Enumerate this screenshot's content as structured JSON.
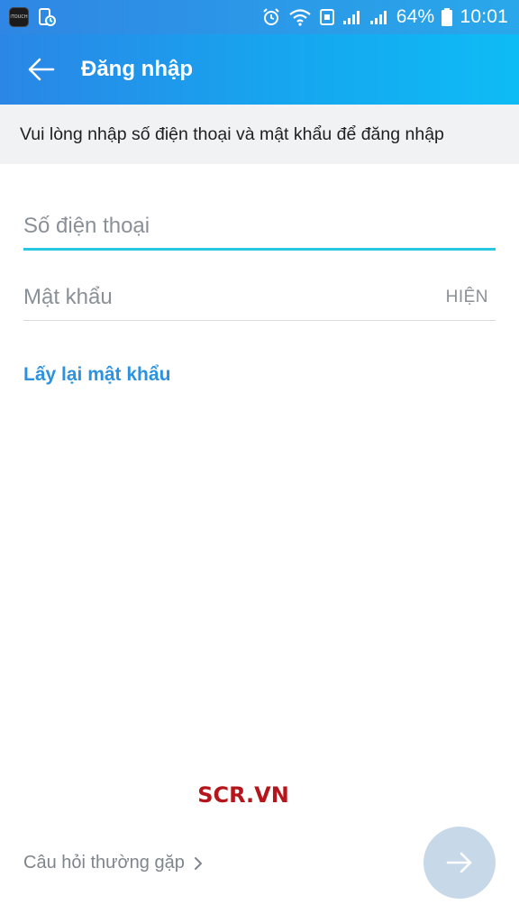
{
  "status_bar": {
    "thumb_text": "iTOUCH",
    "battery": "64%",
    "time": "10:01"
  },
  "app_bar": {
    "title": "Đăng nhập"
  },
  "instruction": "Vui lòng nhập số điện thoại và mật khẩu để đăng nhập",
  "form": {
    "phone_placeholder": "Số điện thoại",
    "password_placeholder": "Mật khẩu",
    "show_label": "HIỆN"
  },
  "forgot_password": "Lấy lại mật khẩu",
  "watermark": "SCR.VN",
  "faq_link": "Câu hỏi thường gặp",
  "colors": {
    "accent": "#2a92e0",
    "focus_underline": "#27c7e0",
    "fab_disabled": "#c7d9e9",
    "watermark": "#b5161b"
  },
  "icons": [
    "back-arrow-icon",
    "chevron-right-icon",
    "arrow-right-icon",
    "alarm-icon",
    "wifi-icon",
    "signal-icon",
    "battery-icon"
  ]
}
